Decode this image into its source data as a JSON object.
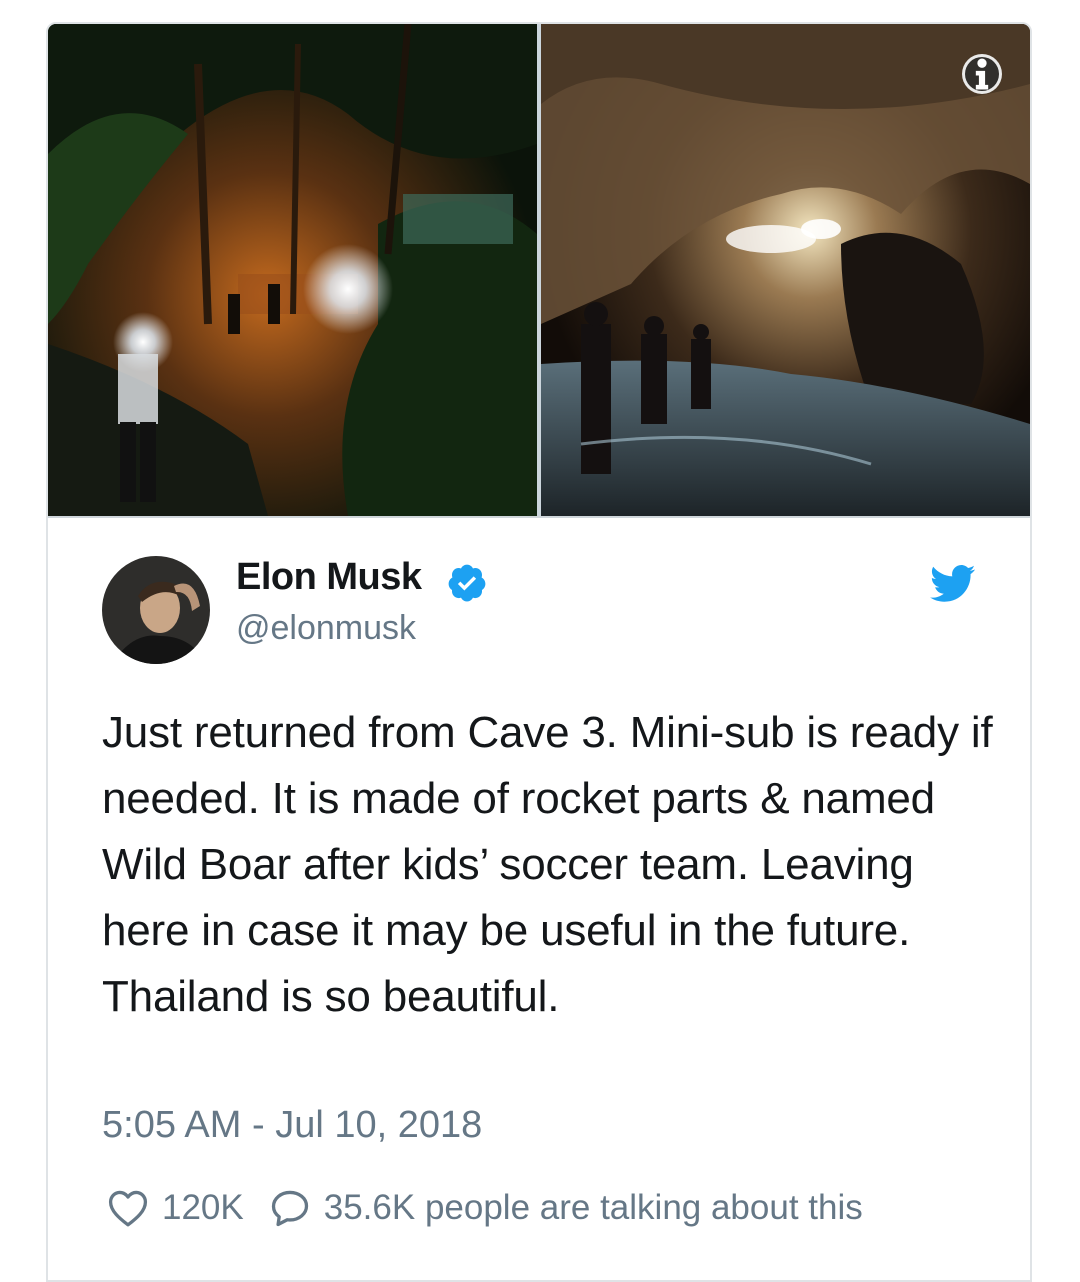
{
  "tweet": {
    "author": {
      "name": "Elon Musk",
      "handle": "@elonmusk",
      "verified": true
    },
    "text": "Just returned from Cave 3. Mini-sub is ready if needed. It is made of rocket parts & named Wild Boar after kids’ soccer team. Leaving here in case it may be useful in the future. Thailand is so beautiful.",
    "timestamp": "5:05 AM - Jul 10, 2018",
    "likes": "120K",
    "talking": "35.6K people are talking about this"
  },
  "icons": {
    "info": "info-icon",
    "verified": "verified-badge-icon",
    "brand": "twitter-bird-icon",
    "like": "heart-icon",
    "reply": "speech-bubble-icon"
  },
  "colors": {
    "brand_blue": "#1da1f2",
    "secondary_text": "#657786",
    "primary_text": "#14171a",
    "card_border": "#dfe3e6"
  }
}
